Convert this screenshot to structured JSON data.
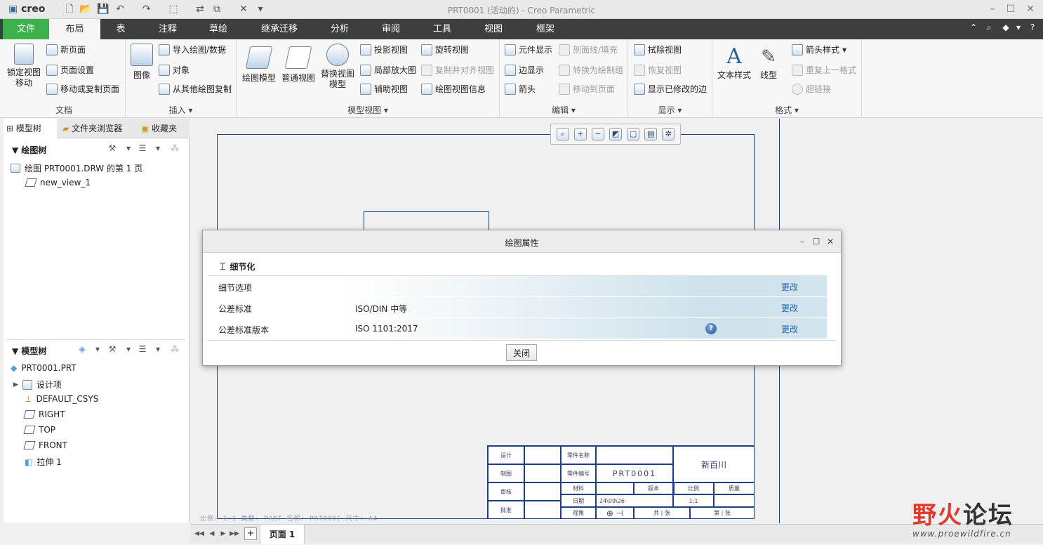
{
  "window": {
    "app_logo": "creo",
    "title": "PRT0001 (活动的) - Creo Parametric"
  },
  "menu_tabs": [
    "文件",
    "布局",
    "表",
    "注释",
    "草绘",
    "继承迁移",
    "分析",
    "审阅",
    "工具",
    "视图",
    "框架"
  ],
  "ribbon": {
    "document": {
      "label": "文档",
      "lock_view": "锁定视图\n移动",
      "new_page": "新页面",
      "page_setup": "页面设置",
      "move_copy_page": "移动或复制页面"
    },
    "insert": {
      "label": "插入",
      "image": "图像",
      "import_drawing": "导入绘图/数据",
      "object": "对象",
      "copy_from_drawing": "从其他绘图复制"
    },
    "model_views": {
      "label": "模型视图",
      "drawing_model": "绘图模型",
      "general_view": "普通视图",
      "replace_view_model": "替换视图\n模型",
      "projection_view": "投影视图",
      "detailed_view": "局部放大图",
      "auxiliary_view": "辅助视图",
      "revolved_view": "旋转视图",
      "copy_align_view": "复制并对齐视图",
      "drawing_view_info": "绘图视图信息"
    },
    "edit": {
      "label": "编辑",
      "component_display": "元件显示",
      "edge_display": "边显示",
      "arrows": "箭头",
      "xhatch": "剖面线/填充",
      "convert_to_draft": "转换为绘制组",
      "move_to_page": "移动到页面"
    },
    "display": {
      "label": "显示",
      "erase_view": "拭除视图",
      "resume_view": "恢复视图",
      "show_modified_edges": "显示已修改的边"
    },
    "format": {
      "label": "格式",
      "text_style": "文本样式",
      "line_style": "线型",
      "arrow_style": "箭头样式",
      "repeat_last_format": "重复上一格式",
      "hyperlink": "超链接"
    }
  },
  "left_panel": {
    "tabs": [
      "模型树",
      "文件夹浏览器",
      "收藏夹"
    ],
    "drawing_tree": {
      "title": "绘图树",
      "items": [
        "绘图 PRT0001.DRW 的第 1 页",
        "new_view_1"
      ]
    },
    "model_tree": {
      "title": "模型树",
      "items": [
        "PRT0001.PRT",
        "设计项",
        "DEFAULT_CSYS",
        "RIGHT",
        "TOP",
        "FRONT",
        "拉伸 1"
      ]
    }
  },
  "title_block": {
    "r1": [
      "设计",
      "零件名称",
      "",
      "新百川"
    ],
    "r2": [
      "制图",
      "零件编号",
      "PRT0001"
    ],
    "r3": [
      "审核",
      "材料",
      "",
      "版本",
      "",
      "比例",
      "质量"
    ],
    "r4": [
      "",
      "日期",
      "24\\09\\26",
      "",
      "1:1"
    ],
    "r5": [
      "批准",
      "视角",
      "",
      "共 | 张",
      "",
      "第 | 张"
    ]
  },
  "status_strip": "比例: 1:1    类型: PART   名称: PRT0001   尺寸: A4",
  "page_tabs": {
    "add": "+",
    "page": "页面 1"
  },
  "dialog": {
    "title": "绘图属性",
    "section": "细节化",
    "rows": [
      {
        "label": "细节选项",
        "value": "",
        "action": "更改"
      },
      {
        "label": "公差标准",
        "value": "ISO/DIN 中等",
        "action": "更改"
      },
      {
        "label": "公差标准版本",
        "value": "ISO 1101:2017",
        "action": "更改"
      }
    ],
    "close_label": "关闭"
  },
  "watermark": {
    "text_red": "野火",
    "text_dark": "论坛",
    "url": "www.proewildfire.cn"
  },
  "colors": {
    "file_tab": "#3cb04b",
    "tab_bar": "#3b3f42",
    "link": "#1b62b0",
    "drawing_line": "#1f3f7f"
  }
}
